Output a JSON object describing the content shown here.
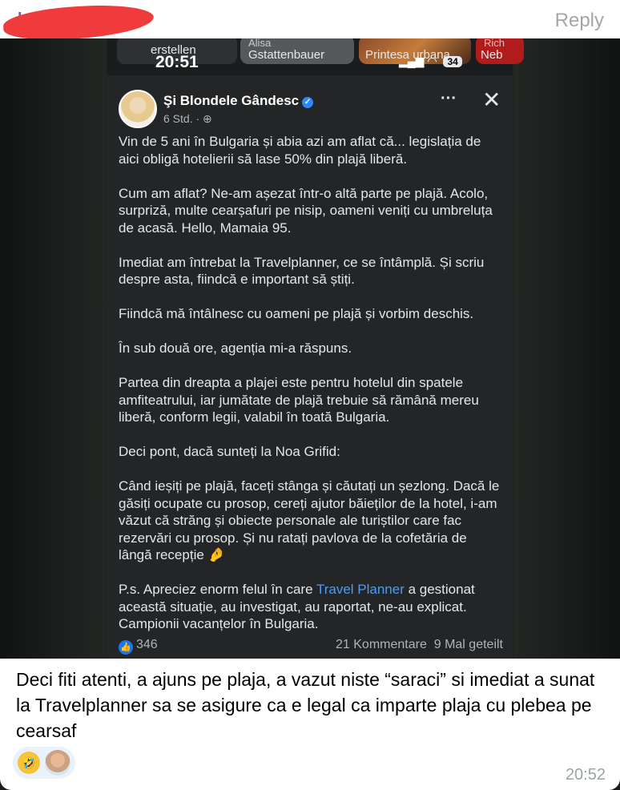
{
  "message": {
    "reply_label": "Reply",
    "time": "20:52",
    "caption": "Deci fiti atenti, a ajuns pe plaja, a vazut niste “saraci” si imediat a sunat la Travelplanner sa se asigure ca e legal ca imparte plaja cu plebea pe cearsaf",
    "reactions": [
      {
        "icon": "rolling-laughing-emoji-icon"
      },
      {
        "icon": "reactor-avatar"
      }
    ]
  },
  "screenshot": {
    "status": {
      "time": "20:51",
      "battery": "34",
      "stories": [
        {
          "label": "erstellen",
          "sub": ""
        },
        {
          "label": "Gstattenbauer",
          "sub": "Alisa"
        },
        {
          "label": "Printesa urbana",
          "sub": ""
        },
        {
          "label": "Neb",
          "sub": "Rich"
        }
      ]
    },
    "post": {
      "author": "Şi Blondele Gândesc",
      "meta": "6 Std. ·",
      "paragraphs": [
        "Vin de 5 ani în Bulgaria și abia azi am aflat că... legislația de aici obligă hotelierii să lase 50% din plajă liberă.",
        "Cum am aflat? Ne-am așezat într-o altă parte pe plajă. Acolo, surpriză, multe cearșafuri pe nisip, oameni veniți cu umbreluța de acasă. Hello, Mamaia 95.",
        "Imediat am întrebat la Travelplanner, ce se întâmplă. Și scriu despre asta, fiindcă e important să știți.",
        "Fiindcă mă întâlnesc cu oameni pe plajă și vorbim deschis.",
        "În sub două ore, agenția mi-a răspuns.",
        "Partea din dreapta a plajei este pentru hotelul din spatele amfiteatrului, iar jumătate de plajă trebuie să rămână mereu liberă, conform legii, valabil în toată Bulgaria.",
        "Deci pont, dacă sunteți la Noa Grifid:",
        "Când ieșiți pe plajă, faceți stânga și căutați un șezlong. Dacă le găsiți ocupate cu prosop, cereți ajutor băieților de la hotel, i-am văzut că străng și obiecte personale ale turiștilor care fac rezervări cu prosop. Și nu ratați pavlova de la cofetăria de lângă recepție 🤌"
      ],
      "ps_before": "P.s. Apreciez enorm felul în care ",
      "ps_link": "Travel Planner",
      "ps_after": " a gestionat această situație, au investigat, au raportat, ne-au explicat. Campionii vacanțelor în Bulgaria.",
      "likes": "346",
      "comments": "21 Kommentare",
      "shares": "9 Mal geteilt"
    }
  }
}
